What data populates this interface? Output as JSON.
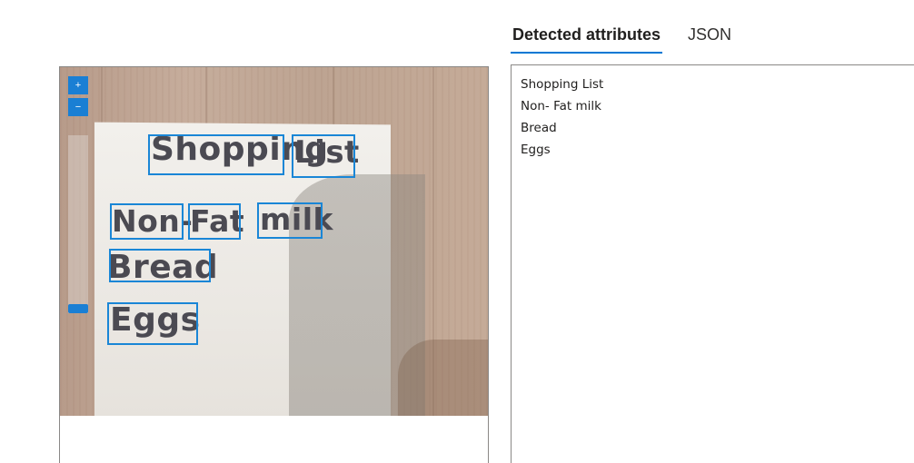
{
  "tabs": [
    {
      "label": "Detected attributes",
      "active": true
    },
    {
      "label": "JSON",
      "active": false
    }
  ],
  "image": {
    "handwriting": [
      "Shopping",
      "List",
      "Non-",
      "Fat",
      "milk",
      "Bread",
      "Eggs"
    ]
  },
  "zoom": {
    "in_icon": "zoom-in-icon",
    "out_icon": "zoom-out-icon",
    "in_glyph": "+",
    "out_glyph": "−"
  },
  "attributes": [
    "Shopping List",
    "Non- Fat milk",
    "Bread",
    "Eggs"
  ],
  "colors": {
    "accent": "#0078d4",
    "bbox": "#1a86d6"
  }
}
